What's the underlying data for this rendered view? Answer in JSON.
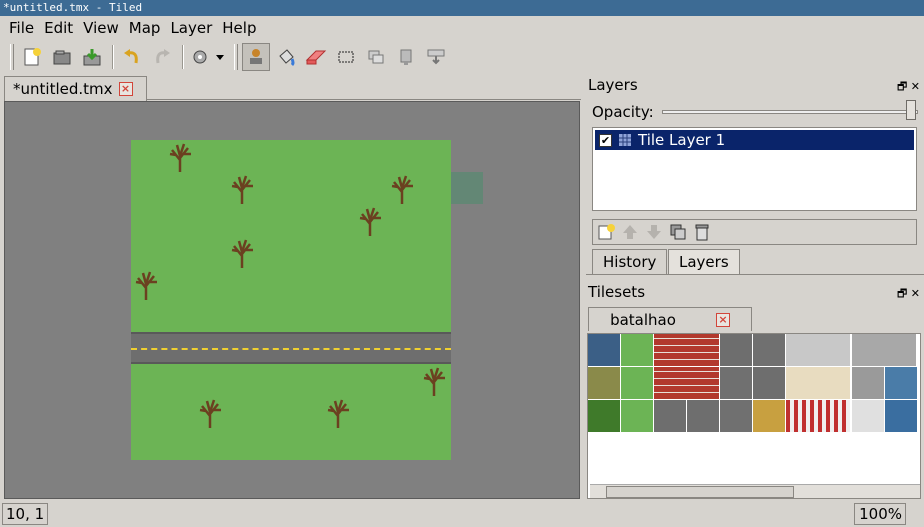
{
  "window": {
    "title": "*untitled.tmx - Tiled"
  },
  "menu": {
    "items": [
      "File",
      "Edit",
      "View",
      "Map",
      "Layer",
      "Help"
    ]
  },
  "toolbar": {
    "icons": [
      "new-icon",
      "open-icon",
      "save-icon",
      "undo-icon",
      "redo-icon",
      "commands-icon",
      "stamp-brush-icon",
      "bucket-fill-icon",
      "eraser-icon",
      "rect-select-icon",
      "magic-wand-icon",
      "select-same-tile-icon",
      "random-mode-icon"
    ]
  },
  "document": {
    "tab_label": "*untitled.tmx"
  },
  "layers_panel": {
    "title": "Layers",
    "opacity_label": "Opacity:",
    "opacity_value": 1.0,
    "layers": [
      {
        "name": "Tile Layer 1",
        "visible": true,
        "selected": true
      }
    ],
    "tabs": [
      "History",
      "Layers"
    ],
    "active_tab": "Layers"
  },
  "tilesets_panel": {
    "title": "Tilesets",
    "tileset_name": "batalhao"
  },
  "status": {
    "coords": "10, 1",
    "zoom": "100%"
  },
  "colors": {
    "grass": "#6cb455",
    "road": "#6e6e6e",
    "road_line": "#f0d030",
    "selection": "#0a246a"
  }
}
